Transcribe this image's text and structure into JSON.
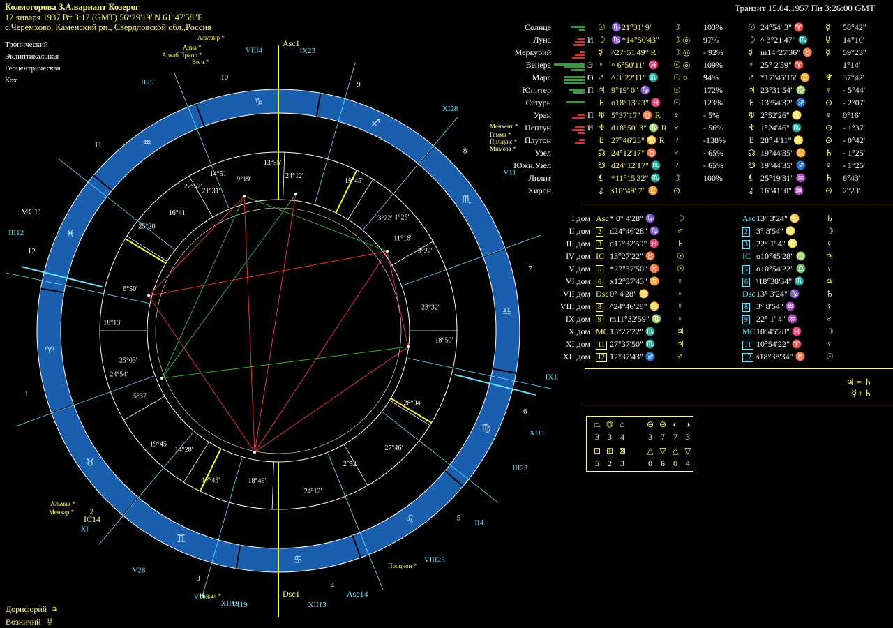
{
  "header": {
    "title": "Колмогорова З.А.вариант Козерог",
    "date_line": "12 января 1937 Вт 3:12 (GMT) 56°29'19\"N 61°47'58\"E",
    "place": "с.Черемхово, Каменский рн., Свердловской обл.,Россия"
  },
  "options": [
    "Тропический",
    "Эклиптикальная",
    "Геоцентрическая",
    "Кох"
  ],
  "transit_title": "Транзит 15.04.1957 Пн 3:26:00 GMT",
  "colors": {
    "background": "#000000",
    "ring": "#1a5fae",
    "text_yellow": "#ffff66",
    "text_cyan": "#5ee6ff",
    "text_red": "#ff3b3b",
    "bar_green": "#22aa22",
    "bar_red": "#ee2222"
  },
  "planets": [
    {
      "name": "Солнце",
      "glyph": "☉",
      "natal": "♑21°31' 9\"",
      "natal_rx": "",
      "aux1": "☽",
      "pct": "103%",
      "tglyph": "☉",
      "transit": "24°54' 3\" ♈",
      "ruler": "☿",
      "delta": "58°42\""
    },
    {
      "name": "Луна",
      "glyph": "☽",
      "natal": "♑*14°50'43\"",
      "natal_rx": "",
      "aux1": "☽ ◎",
      "pct": "97%",
      "tglyph": "☽",
      "transit": "^ 3°21'47\" ♏",
      "ruler": "☿",
      "delta": "14°10'"
    },
    {
      "name": "Меркурий",
      "glyph": "☿",
      "natal": "^27°51'49\"",
      "natal_rx": "R",
      "aux1": "☽ ◎",
      "pct": "- 92%",
      "tglyph": "☿",
      "transit": "m14°27'36\" ♉",
      "ruler": "☿",
      "delta": "59°23\""
    },
    {
      "name": "Венера",
      "glyph": "♀",
      "natal": "^ 6°50'11\" ♓",
      "natal_rx": "",
      "aux1": "☉ ◎",
      "pct": "109%",
      "tglyph": "♀",
      "transit": "25° 2'59\" ♈",
      "ruler": "",
      "delta": "1°14'"
    },
    {
      "name": "Марс",
      "glyph": "♂",
      "natal": "^ 3°22'11\" ♏",
      "natal_rx": "",
      "aux1": "☉ ○",
      "pct": "94%",
      "tglyph": "♂",
      "transit": "*17°45'15\" ♊",
      "ruler": "♆",
      "delta": "37°42'"
    },
    {
      "name": "Юпитер",
      "glyph": "♃",
      "natal": "9°19' 0\" ♑",
      "natal_rx": "",
      "aux1": "☉",
      "pct": "172%",
      "tglyph": "♃",
      "transit": "23°31'54\" ♍",
      "ruler": "♀",
      "delta": "- 5°44'"
    },
    {
      "name": "Сатурн",
      "glyph": "♄",
      "natal": "o18°13'23\" ♓",
      "natal_rx": "",
      "aux1": "☉",
      "pct": "123%",
      "tglyph": "♄",
      "transit": "13°54'32\" ♐",
      "ruler": "⊙",
      "delta": "- 2°07'"
    },
    {
      "name": "Уран",
      "glyph": "♅",
      "natal": "5°37'17\" ♉",
      "natal_rx": "R",
      "aux1": "♀",
      "pct": "- 5%",
      "tglyph": "♅",
      "transit": "2°52'26\" ♌",
      "ruler": "♀",
      "delta": "0°16'"
    },
    {
      "name": "Нептун",
      "glyph": "♆",
      "natal": "d18°50' 3\" ♍",
      "natal_rx": "R",
      "aux1": "♂",
      "pct": "- 56%",
      "tglyph": "♆",
      "transit": "1°24'46\" ♏",
      "ruler": "⊙",
      "delta": "- 1°37'"
    },
    {
      "name": "Плутон",
      "glyph": "♇",
      "natal": "27°46'23\" ♋",
      "natal_rx": "R",
      "aux1": "♂",
      "pct": "-138%",
      "tglyph": "♇",
      "transit": "28° 4'11\" ♌",
      "ruler": "⊙",
      "delta": "- 0°42'"
    },
    {
      "name": "Узел",
      "glyph": "☊",
      "natal": "24°12'17\" ♉",
      "natal_rx": "",
      "aux1": "♂",
      "pct": "- 65%",
      "tglyph": "☊",
      "transit": "19°44'35\" ♊",
      "ruler": "♄",
      "delta": "- 1°25'"
    },
    {
      "name": "Южн.Узел",
      "glyph": "☋",
      "natal": "d24°12'17\" ♏",
      "natal_rx": "",
      "aux1": "♂",
      "pct": "- 65%",
      "tglyph": "☋",
      "transit": "19°44'35\" ♐",
      "ruler": "♀",
      "delta": "- 1°25'"
    },
    {
      "name": "Лилит",
      "glyph": "⚸",
      "natal": "*11°15'32\" ♏",
      "natal_rx": "",
      "aux1": "☽",
      "pct": "100%",
      "tglyph": "⚸",
      "transit": "25°19'31\" ♒",
      "ruler": "♄",
      "delta": "6°43'"
    },
    {
      "name": "Хирон",
      "glyph": "⚷",
      "natal": "s18°49' 7\" ♊",
      "natal_rx": "",
      "aux1": "⊙",
      "pct": "",
      "tglyph": "⚷",
      "transit": "16°41' 0\" ♒",
      "ruler": "⊙",
      "delta": "2°23'"
    }
  ],
  "planet_bars": [
    {
      "color": "green",
      "widths": [
        20,
        8
      ]
    },
    {
      "color": "red",
      "widths": [
        10,
        14,
        16
      ]
    },
    {
      "color": "red",
      "widths": [
        6,
        14,
        18
      ]
    },
    {
      "color": "green",
      "widths": [
        44,
        30,
        20
      ]
    },
    {
      "color": "green",
      "widths": [
        30,
        30,
        30
      ]
    },
    {
      "color": "green",
      "widths": [
        22,
        16
      ]
    },
    {
      "color": "green",
      "widths": [
        26
      ]
    },
    {
      "color": "red",
      "widths": [
        10,
        18
      ]
    },
    {
      "color": "red",
      "widths": [
        14,
        18,
        10
      ]
    },
    {
      "color": "red",
      "widths": [
        8,
        14
      ]
    }
  ],
  "planet_markers": [
    "",
    "И",
    "",
    "Э",
    "О",
    "П",
    "",
    "П",
    "И",
    ""
  ],
  "houses": [
    {
      "label": "I дом",
      "hg": "Asc",
      "natal": "* 0° 4'28\" ♑",
      "ruler": "☽",
      "tg": "Asc",
      "transit": "13° 3'24\" ♋",
      "truler": "♄"
    },
    {
      "label": "II дом",
      "hg": "2",
      "natal": "d24°46'28\" ♑",
      "ruler": "♂",
      "tg": "2",
      "transit": "3° 8'54\" ♌",
      "truler": "☽"
    },
    {
      "label": "III дом",
      "hg": "3",
      "natal": "d11°32'59\" ♓",
      "ruler": "♄",
      "tg": "3",
      "transit": "22° 1' 4\" ♌",
      "truler": "♀"
    },
    {
      "label": "IV дом",
      "hg": "IC",
      "natal": "13°27'22\" ♉",
      "ruler": "☉",
      "tg": "IC",
      "transit": "o10°45'28\" ♍",
      "truler": "♃"
    },
    {
      "label": "V дом",
      "hg": "5",
      "natal": "*27°37'50\" ♉",
      "ruler": "☉",
      "tg": "5",
      "transit": "o10°54'22\" ♎",
      "truler": "♀"
    },
    {
      "label": "VI дом",
      "hg": "6",
      "natal": "x12°37'43\" ♊",
      "ruler": "♀",
      "tg": "6",
      "transit": "\\18°38'34\" ♏",
      "truler": "♃"
    },
    {
      "label": "VII дом",
      "hg": "Dsc",
      "natal": "0° 4'28\" ♋",
      "ruler": "♀",
      "tg": "Dsc",
      "transit": "13° 3'24\" ♑",
      "truler": "♄"
    },
    {
      "label": "VIII дом",
      "hg": "8",
      "natal": "^24°46'28\" ♋",
      "ruler": "♀",
      "tg": "8",
      "transit": "3° 8'54\" ♒",
      "truler": "♀"
    },
    {
      "label": "IX дом",
      "hg": "9",
      "natal": "m11°32'59\" ♍",
      "ruler": "♀",
      "tg": "9",
      "transit": "22° 1' 4\" ♒",
      "truler": "♂"
    },
    {
      "label": "X дом",
      "hg": "MC",
      "natal": "13°27'22\" ♏",
      "ruler": "♃",
      "tg": "MC",
      "transit": "10°45'28\" ♓",
      "truler": "☽"
    },
    {
      "label": "XI дом",
      "hg": "11",
      "natal": "27°37'50\" ♏",
      "ruler": "♃",
      "tg": "11",
      "transit": "10°54'22\" ♈",
      "truler": "♀"
    },
    {
      "label": "XII дом",
      "hg": "12",
      "natal": "12°37'43\" ♐",
      "ruler": "♂",
      "tg": "12",
      "transit": "s18°38'34\" ♉",
      "truler": "☉"
    }
  ],
  "aspect_notes": [
    "♃ = ♄",
    "☿ t ♄"
  ],
  "elements": {
    "row1_counts": [
      "3",
      "3",
      "4",
      "3",
      "7",
      "7",
      "3"
    ],
    "row2_counts": [
      "5",
      "2",
      "3",
      "0",
      "6",
      "0",
      "4"
    ]
  },
  "footer": [
    {
      "label": "Дорифорий",
      "glyph": "♃"
    },
    {
      "label": "Возничий",
      "glyph": "☿"
    }
  ],
  "chart": {
    "signs": [
      "♈",
      "♉",
      "♊",
      "♋",
      "♌",
      "♍",
      "♎",
      "♏",
      "♐",
      "♑",
      "♒",
      "♓"
    ],
    "house_numbers_natal": [
      "1",
      "2",
      "3",
      "4",
      "5",
      "6",
      "7",
      "8",
      "9",
      "10",
      "11",
      "12"
    ],
    "axis_labels": {
      "asc": "Asc",
      "asc_sup": "1",
      "dsc": "Dsc",
      "dsc_sup": "1",
      "mc": "MC",
      "mc_sup": "11",
      "ic": "IC",
      "ic_sup": "14",
      "asc_t": "Asc",
      "asc_t_sup": "14"
    },
    "transit_house_labels": [
      {
        "t": "II",
        "s": "25"
      },
      {
        "t": "VIII",
        "s": "4"
      },
      {
        "t": "IX",
        "s": "23"
      },
      {
        "t": "III",
        "s": "12"
      },
      {
        "t": "VI",
        "s": "19"
      },
      {
        "t": "XII",
        "s": "13"
      },
      {
        "t": "XI",
        "s": "28"
      },
      {
        "t": "V",
        "s": "11"
      },
      {
        "t": "IX",
        "s": "12"
      },
      {
        "t": "XI",
        "s": "11"
      },
      {
        "t": "III",
        "s": "23"
      },
      {
        "t": "II",
        "s": "4"
      },
      {
        "t": "VIII",
        "s": "25"
      },
      {
        "t": "XII",
        "s": "19"
      },
      {
        "t": "VI",
        "s": "13"
      },
      {
        "t": "V",
        "s": "28"
      },
      {
        "t": "XI",
        "s": ""
      },
      {
        "t": "Dsc",
        "s": "14"
      }
    ],
    "stars": [
      "Альтаир",
      "Адиа",
      "Аркаб Приор",
      "Вега",
      "Менкент",
      "Гемма",
      "Поллукс",
      "Мимоза",
      "Альмак",
      "Менкар",
      "Процион",
      "Нихал",
      "Альфард"
    ],
    "inner_labels": [
      "9°19'",
      "14°51'",
      "21°31'",
      "27°52'",
      "24°12'",
      "19°45'",
      "3°22'",
      "1°25'",
      "11°16'",
      "3°22'",
      "23°32'",
      "18°50'",
      "28°04'",
      "27°46'",
      "2°52'",
      "24°12'",
      "18°49'",
      "17°45'",
      "14°28'",
      "19°45'",
      "5°37'",
      "24°54'",
      "25°03'",
      "18°13'",
      "6°50'",
      "25°20'",
      "16°41'",
      "13°55'"
    ]
  }
}
